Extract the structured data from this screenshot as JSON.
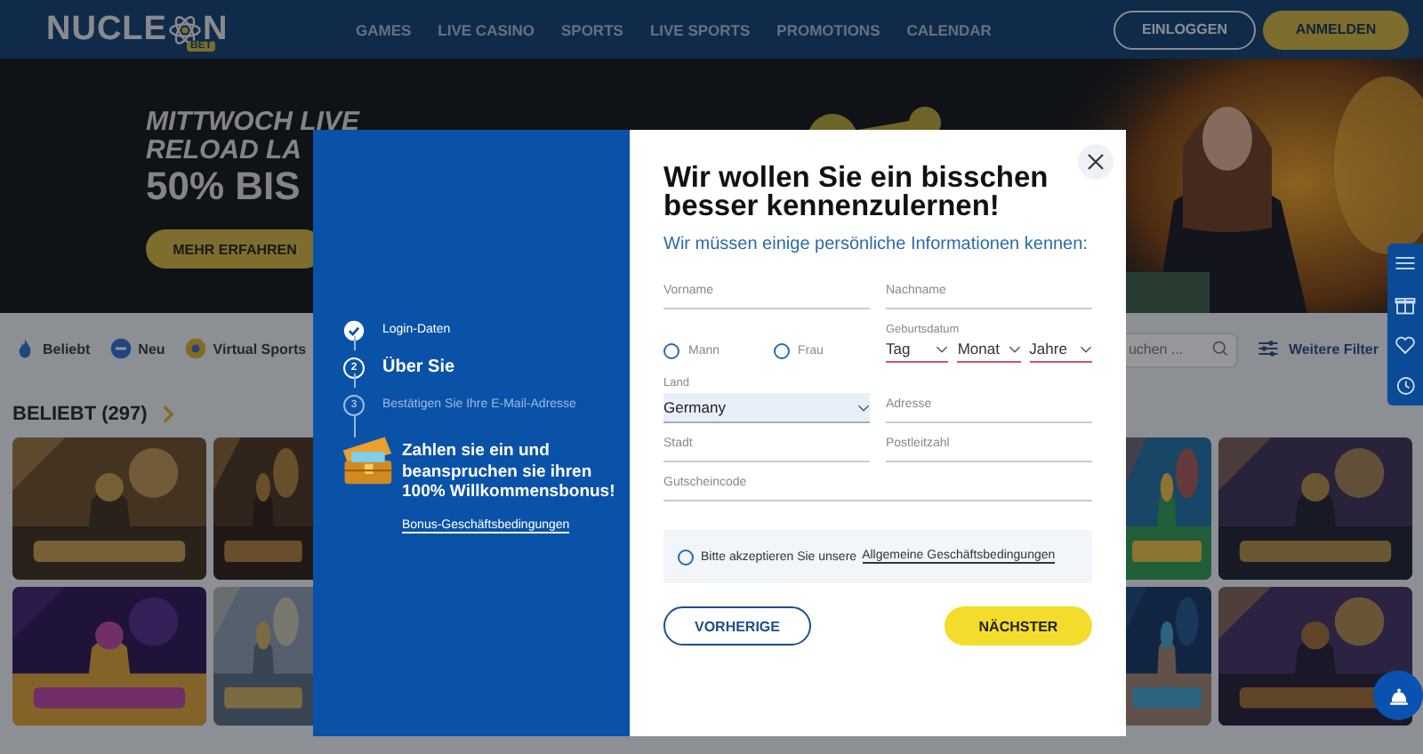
{
  "header": {
    "logo": {
      "text_start": "NUCLE",
      "text_end": "N",
      "badge": "BET"
    },
    "nav": [
      {
        "label": "GAMES"
      },
      {
        "label": "LIVE CASINO"
      },
      {
        "label": "SPORTS"
      },
      {
        "label": "LIVE SPORTS"
      },
      {
        "label": "PROMOTIONS"
      },
      {
        "label": "CALENDAR"
      }
    ],
    "login_button": "EINLOGGEN",
    "register_button": "ANMELDEN"
  },
  "hero": {
    "lines": [
      "MITTWOCH LIVE",
      "RELOAD LA",
      "50% BIS"
    ],
    "button": "MEHR ERFAHREN"
  },
  "categories": [
    {
      "label": "Beliebt",
      "kind": "flame"
    },
    {
      "label": "Neu",
      "kind": "new"
    },
    {
      "label": "Virtual Sports",
      "kind": "ball"
    }
  ],
  "search": {
    "placeholder": "uchen ..."
  },
  "filter_button": "Weitere Filter",
  "section_title": "BELIEBT (297)",
  "modal": {
    "steps": [
      {
        "label": "Login-Daten",
        "done": true,
        "current": false
      },
      {
        "label": "Über Sie",
        "number": "2",
        "done": false,
        "current": true
      },
      {
        "label": "Bestätigen Sie Ihre E-Mail-Adresse",
        "number": "3",
        "done": false,
        "current": false
      }
    ],
    "promo": "Zahlen sie ein und beanspruchen sie ihren 100% Willkommensbonus!",
    "promo_link": "Bonus-Geschäftsbedingungen",
    "title": "Wir wollen Sie ein bisschen besser kennenzulernen!",
    "subtitle": "Wir müssen einige persönliche Informationen kennen:",
    "form": [
      {
        "kind": "text",
        "placeholder": "Vorname"
      },
      {
        "kind": "text",
        "placeholder": "Nachname"
      },
      {
        "kind": "radios",
        "options": [
          {
            "label": "Mann",
            "selected": false
          },
          {
            "label": "Frau",
            "selected": false
          }
        ]
      },
      {
        "kind": "date",
        "label": "Geburtsdatum",
        "parts": [
          {
            "placeholder": "Tag",
            "invalid": true
          },
          {
            "placeholder": "Monat",
            "invalid": true
          },
          {
            "placeholder": "Jahre",
            "invalid": true
          }
        ]
      },
      {
        "kind": "select",
        "label": "Land",
        "value": "Germany"
      },
      {
        "kind": "text",
        "placeholder": "Adresse"
      },
      {
        "kind": "text",
        "placeholder": "Stadt"
      },
      {
        "kind": "text",
        "placeholder": "Postleitzahl"
      },
      {
        "kind": "text",
        "placeholder": "Gutscheincode",
        "wide": true
      }
    ],
    "terms": {
      "text": "Bitte akzeptieren Sie unsere",
      "link": "Allgemeine Geschäftsbedingungen",
      "checked": false
    },
    "back_button": "VORHERIGE",
    "next_button": "NÄCHSTER"
  }
}
